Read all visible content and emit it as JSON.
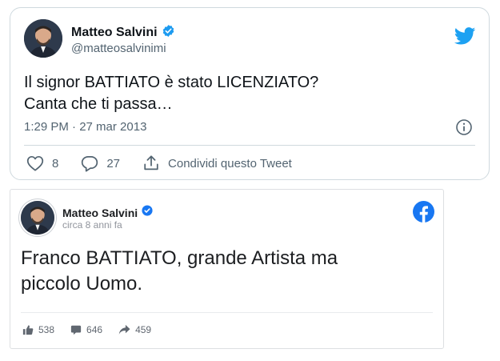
{
  "twitter": {
    "author_name": "Matteo Salvini",
    "handle": "@matteosalvinimi",
    "text_line1": "Il signor BATTIATO è stato LICENZIATO?",
    "text_line2": "Canta che ti passa…",
    "timestamp": "1:29 PM · 27 mar 2013",
    "likes": "8",
    "replies": "27",
    "share_label": "Condividi questo Tweet",
    "brand_color": "#1da1f2",
    "icons": [
      "verified-badge-icon",
      "twitter-bird-icon",
      "info-icon",
      "heart-icon",
      "reply-icon",
      "share-icon"
    ]
  },
  "facebook": {
    "author_name": "Matteo Salvini",
    "time": "circa 8 anni fa",
    "text_line1": "Franco BATTIATO, grande Artista ma",
    "text_line2": "piccolo Uomo.",
    "likes": "538",
    "comments": "646",
    "shares": "459",
    "brand_color": "#1877f2",
    "icons": [
      "verified-badge-icon",
      "facebook-logo-icon",
      "like-icon",
      "comment-icon",
      "share-arrow-icon"
    ]
  }
}
